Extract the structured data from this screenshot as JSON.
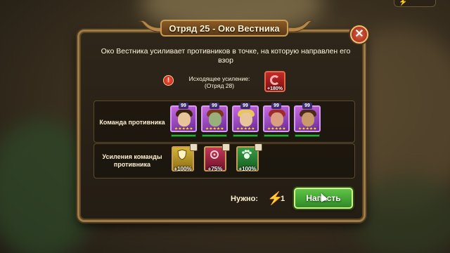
{
  "dialog": {
    "title": "Отряд 25 - Око Вестника",
    "close_label": "✕",
    "description": "Око Вестника усиливает противников в точке, на которую направлен его взор"
  },
  "boost": {
    "label": "Исходящее усиление:",
    "sublabel": "(Отряд 28)",
    "value": "+180%",
    "icon": "red-swirl-icon"
  },
  "enemy_team": {
    "label": "Команда противника",
    "heroes": [
      {
        "level": "99",
        "stars": "★★★★★",
        "icon": "hero-portrait-1"
      },
      {
        "level": "99",
        "stars": "★★★★★",
        "icon": "hero-portrait-2"
      },
      {
        "level": "99",
        "stars": "★★★★★",
        "icon": "hero-portrait-3"
      },
      {
        "level": "99",
        "stars": "★★★★★",
        "icon": "hero-portrait-4"
      },
      {
        "level": "99",
        "stars": "★★★★★",
        "icon": "hero-portrait-5"
      }
    ]
  },
  "enemy_buffs": {
    "label": "Усиления команды противника",
    "items": [
      {
        "value": "+100%",
        "icon": "shield-icon",
        "color": "#c9a32a"
      },
      {
        "value": "+75%",
        "icon": "crosshair-icon",
        "color": "#b02a4a"
      },
      {
        "value": "+100%",
        "icon": "paw-icon",
        "color": "#2f8a3a"
      }
    ]
  },
  "cost": {
    "label": "Нужно:",
    "icon": "lightning-icon",
    "value": "1"
  },
  "attack_button": {
    "label": "Напасть"
  },
  "colors": {
    "accent_gold": "#c99b55",
    "button_green": "#4fb83a",
    "energy_pink": "#ff5f86"
  }
}
